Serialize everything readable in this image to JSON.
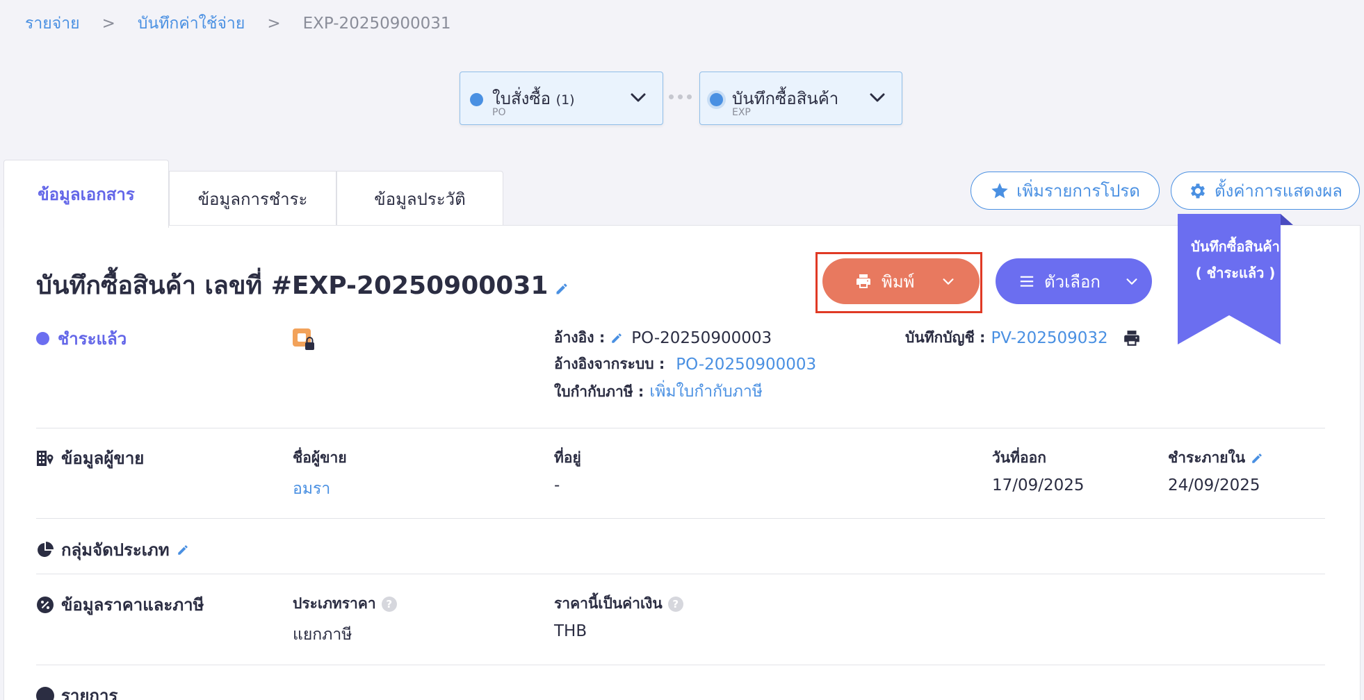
{
  "breadcrumb": {
    "items": [
      "รายจ่าย",
      "บันทึกค่าใช้จ่าย"
    ],
    "separator": ">",
    "current": "EXP-20250900031"
  },
  "flow": {
    "po": {
      "title": "ใบสั่งซื้อ",
      "count": "(1)",
      "sub": "PO"
    },
    "exp": {
      "title": "บันทึกซื้อสินค้า",
      "sub": "EXP"
    }
  },
  "tabs": [
    "ข้อมูลเอกสาร",
    "ข้อมูลการชำระ",
    "ข้อมูลประวัติ"
  ],
  "actions": {
    "favorite_label": "เพิ่มรายการโปรด",
    "display_settings_label": "ตั้งค่าการแสดงผล",
    "print_label": "พิมพ์",
    "options_label": "ตัวเลือก"
  },
  "document": {
    "title": "บันทึกซื้อสินค้า เลขที่ #EXP-20250900031",
    "status": "ชำระแล้ว",
    "ribbon_line1": "บันทึกซื้อสินค้า",
    "ribbon_line2": "( ชำระแล้ว )",
    "reference_label": "อ้างอิง :",
    "reference_value": "PO-20250900003",
    "system_reference_label": "อ้างอิงจากระบบ :",
    "system_reference_value": "PO-20250900003",
    "tax_invoice_label": "ใบกำกับภาษี :",
    "tax_invoice_link": "เพิ่มใบกำกับภาษี",
    "account_entry_label": "บันทึกบัญชี :",
    "account_entry_value": "PV-202509032"
  },
  "vendor": {
    "section_title": "ข้อมูลผู้ขาย",
    "name_label": "ชื่อผู้ขาย",
    "name_value": "อมรา",
    "address_label": "ที่อยู่",
    "address_value": "-",
    "issue_date_label": "วันที่ออก",
    "issue_date_value": "17/09/2025",
    "due_label": "ชำระภายใน",
    "due_value": "24/09/2025"
  },
  "category": {
    "section_title": "กลุ่มจัดประเภท"
  },
  "pricing": {
    "section_title": "ข้อมูลราคาและภาษี",
    "price_type_label": "ประเภทราคา",
    "price_type_value": "แยกภาษี",
    "currency_label": "ราคานี้เป็นค่าเงิน",
    "currency_value": "THB"
  },
  "items": {
    "section_title": "รายการ"
  },
  "colors": {
    "accent": "#6366e8",
    "link": "#4a90e2",
    "print_button": "#e8795f",
    "options_button": "#6b6ef0",
    "highlight_frame": "#e03a25"
  }
}
